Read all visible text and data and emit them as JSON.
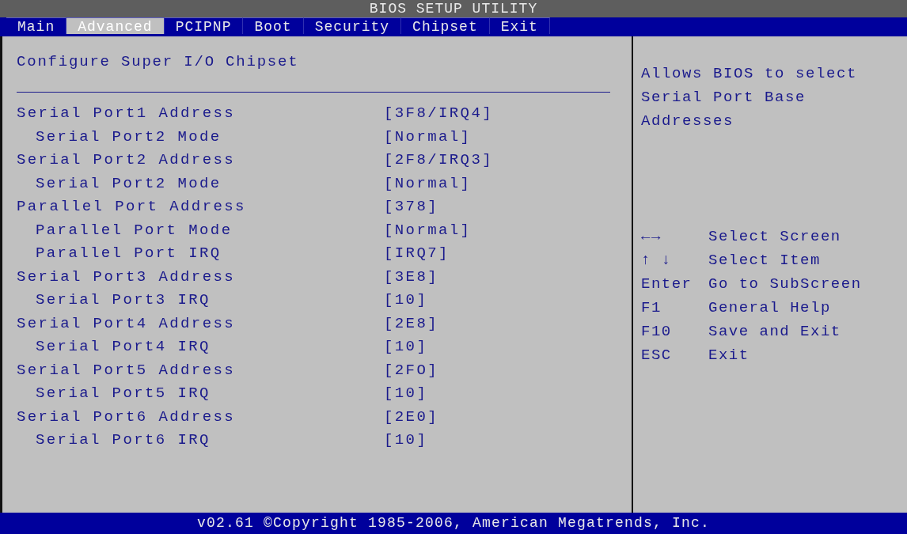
{
  "window": {
    "title": "BIOS SETUP UTILITY"
  },
  "tabs": [
    {
      "label": "Main",
      "selected": false
    },
    {
      "label": "Advanced",
      "selected": true
    },
    {
      "label": "PCIPNP",
      "selected": false
    },
    {
      "label": "Boot",
      "selected": false
    },
    {
      "label": "Security",
      "selected": false
    },
    {
      "label": "Chipset",
      "selected": false
    },
    {
      "label": "Exit",
      "selected": false
    }
  ],
  "section_title": "Configure Super I/O Chipset",
  "settings": [
    {
      "label": "Serial Port1 Address",
      "value": "[3F8/IRQ4]",
      "kind": "item"
    },
    {
      "label": "Serial Port2 Mode",
      "value": "[Normal]",
      "kind": "subitem"
    },
    {
      "label": "Serial Port2 Address",
      "value": "[2F8/IRQ3]",
      "kind": "item"
    },
    {
      "label": "Serial Port2 Mode",
      "value": "[Normal]",
      "kind": "subitem"
    },
    {
      "label": "Parallel Port Address",
      "value": "[378]",
      "kind": "item"
    },
    {
      "label": "Parallel Port Mode",
      "value": "[Normal]",
      "kind": "subitem"
    },
    {
      "label": "Parallel Port IRQ",
      "value": "[IRQ7]",
      "kind": "subitem"
    },
    {
      "label": "Serial Port3 Address",
      "value": "[3E8]",
      "kind": "item"
    },
    {
      "label": "Serial Port3 IRQ",
      "value": "[10]",
      "kind": "subitem"
    },
    {
      "label": "Serial Port4 Address",
      "value": "[2E8]",
      "kind": "item"
    },
    {
      "label": "Serial Port4 IRQ",
      "value": "[10]",
      "kind": "subitem"
    },
    {
      "label": "Serial Port5 Address",
      "value": "[2FO]",
      "kind": "item"
    },
    {
      "label": "Serial Port5 IRQ",
      "value": "[10]",
      "kind": "subitem"
    },
    {
      "label": "Serial Port6 Address",
      "value": "[2E0]",
      "kind": "item"
    },
    {
      "label": "Serial Port6 IRQ",
      "value": "[10]",
      "kind": "subitem"
    }
  ],
  "help_text": "Allows BIOS to select Serial Port Base Addresses",
  "key_legend": [
    {
      "key": "←→",
      "action": "Select Screen"
    },
    {
      "key": "↑ ↓",
      "action": "Select Item"
    },
    {
      "key": "Enter",
      "action": "Go to SubScreen"
    },
    {
      "key": "F1",
      "action": "General Help"
    },
    {
      "key": "F10",
      "action": "Save and Exit"
    },
    {
      "key": "ESC",
      "action": "Exit"
    }
  ],
  "status_bar": "v02.61 ©Copyright 1985-2006, American Megatrends, Inc."
}
